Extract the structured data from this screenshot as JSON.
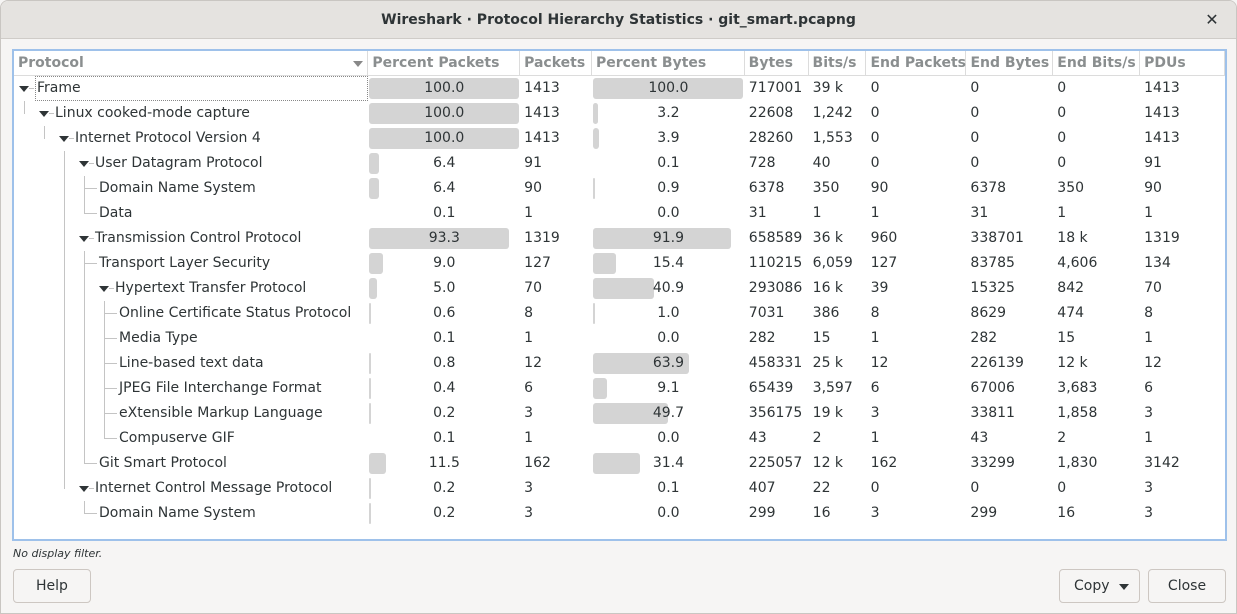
{
  "window": {
    "title": "Wireshark · Protocol Hierarchy Statistics · git_smart.pcapng",
    "close_icon": "close-x-icon"
  },
  "table": {
    "columns": [
      "Protocol",
      "Percent Packets",
      "Packets",
      "Percent Bytes",
      "Bytes",
      "Bits/s",
      "End Packets",
      "End Bytes",
      "End Bits/s",
      "PDUs"
    ],
    "sort_column": "Protocol",
    "rows": [
      {
        "protocol": "Frame",
        "depth": 0,
        "expanded": true,
        "pct_packets": "100.0",
        "packets": "1413",
        "pct_bytes": "100.0",
        "bytes": "717001",
        "bits_s": "39 k",
        "end_packets": "0",
        "end_bytes": "0",
        "end_bits_s": "0",
        "pdus": "1413",
        "pct_packets_val": 100.0,
        "pct_bytes_val": 100.0
      },
      {
        "protocol": "Linux cooked-mode capture",
        "depth": 1,
        "expanded": true,
        "pct_packets": "100.0",
        "packets": "1413",
        "pct_bytes": "3.2",
        "bytes": "22608",
        "bits_s": "1,242",
        "end_packets": "0",
        "end_bytes": "0",
        "end_bits_s": "0",
        "pdus": "1413",
        "pct_packets_val": 100.0,
        "pct_bytes_val": 3.2
      },
      {
        "protocol": "Internet Protocol Version 4",
        "depth": 2,
        "expanded": true,
        "pct_packets": "100.0",
        "packets": "1413",
        "pct_bytes": "3.9",
        "bytes": "28260",
        "bits_s": "1,553",
        "end_packets": "0",
        "end_bytes": "0",
        "end_bits_s": "0",
        "pdus": "1413",
        "pct_packets_val": 100.0,
        "pct_bytes_val": 3.9
      },
      {
        "protocol": "User Datagram Protocol",
        "depth": 3,
        "expanded": true,
        "pct_packets": "6.4",
        "packets": "91",
        "pct_bytes": "0.1",
        "bytes": "728",
        "bits_s": "40",
        "end_packets": "0",
        "end_bytes": "0",
        "end_bits_s": "0",
        "pdus": "91",
        "pct_packets_val": 6.4,
        "pct_bytes_val": 0.1
      },
      {
        "protocol": "Domain Name System",
        "depth": 4,
        "expanded": null,
        "pct_packets": "6.4",
        "packets": "90",
        "pct_bytes": "0.9",
        "bytes": "6378",
        "bits_s": "350",
        "end_packets": "90",
        "end_bytes": "6378",
        "end_bits_s": "350",
        "pdus": "90",
        "pct_packets_val": 6.4,
        "pct_bytes_val": 0.9
      },
      {
        "protocol": "Data",
        "depth": 4,
        "expanded": null,
        "pct_packets": "0.1",
        "packets": "1",
        "pct_bytes": "0.0",
        "bytes": "31",
        "bits_s": "1",
        "end_packets": "1",
        "end_bytes": "31",
        "end_bits_s": "1",
        "pdus": "1",
        "pct_packets_val": 0.1,
        "pct_bytes_val": 0.0
      },
      {
        "protocol": "Transmission Control Protocol",
        "depth": 3,
        "expanded": true,
        "pct_packets": "93.3",
        "packets": "1319",
        "pct_bytes": "91.9",
        "bytes": "658589",
        "bits_s": "36 k",
        "end_packets": "960",
        "end_bytes": "338701",
        "end_bits_s": "18 k",
        "pdus": "1319",
        "pct_packets_val": 93.3,
        "pct_bytes_val": 91.9
      },
      {
        "protocol": "Transport Layer Security",
        "depth": 4,
        "expanded": null,
        "pct_packets": "9.0",
        "packets": "127",
        "pct_bytes": "15.4",
        "bytes": "110215",
        "bits_s": "6,059",
        "end_packets": "127",
        "end_bytes": "83785",
        "end_bits_s": "4,606",
        "pdus": "134",
        "pct_packets_val": 9.0,
        "pct_bytes_val": 15.4
      },
      {
        "protocol": "Hypertext Transfer Protocol",
        "depth": 4,
        "expanded": true,
        "pct_packets": "5.0",
        "packets": "70",
        "pct_bytes": "40.9",
        "bytes": "293086",
        "bits_s": "16 k",
        "end_packets": "39",
        "end_bytes": "15325",
        "end_bits_s": "842",
        "pdus": "70",
        "pct_packets_val": 5.0,
        "pct_bytes_val": 40.9
      },
      {
        "protocol": "Online Certificate Status Protocol",
        "depth": 5,
        "expanded": null,
        "pct_packets": "0.6",
        "packets": "8",
        "pct_bytes": "1.0",
        "bytes": "7031",
        "bits_s": "386",
        "end_packets": "8",
        "end_bytes": "8629",
        "end_bits_s": "474",
        "pdus": "8",
        "pct_packets_val": 0.6,
        "pct_bytes_val": 1.0
      },
      {
        "protocol": "Media Type",
        "depth": 5,
        "expanded": null,
        "pct_packets": "0.1",
        "packets": "1",
        "pct_bytes": "0.0",
        "bytes": "282",
        "bits_s": "15",
        "end_packets": "1",
        "end_bytes": "282",
        "end_bits_s": "15",
        "pdus": "1",
        "pct_packets_val": 0.1,
        "pct_bytes_val": 0.0
      },
      {
        "protocol": "Line-based text data",
        "depth": 5,
        "expanded": null,
        "pct_packets": "0.8",
        "packets": "12",
        "pct_bytes": "63.9",
        "bytes": "458331",
        "bits_s": "25 k",
        "end_packets": "12",
        "end_bytes": "226139",
        "end_bits_s": "12 k",
        "pdus": "12",
        "pct_packets_val": 0.8,
        "pct_bytes_val": 63.9
      },
      {
        "protocol": "JPEG File Interchange Format",
        "depth": 5,
        "expanded": null,
        "pct_packets": "0.4",
        "packets": "6",
        "pct_bytes": "9.1",
        "bytes": "65439",
        "bits_s": "3,597",
        "end_packets": "6",
        "end_bytes": "67006",
        "end_bits_s": "3,683",
        "pdus": "6",
        "pct_packets_val": 0.4,
        "pct_bytes_val": 9.1
      },
      {
        "protocol": "eXtensible Markup Language",
        "depth": 5,
        "expanded": null,
        "pct_packets": "0.2",
        "packets": "3",
        "pct_bytes": "49.7",
        "bytes": "356175",
        "bits_s": "19 k",
        "end_packets": "3",
        "end_bytes": "33811",
        "end_bits_s": "1,858",
        "pdus": "3",
        "pct_packets_val": 0.2,
        "pct_bytes_val": 49.7
      },
      {
        "protocol": "Compuserve GIF",
        "depth": 5,
        "expanded": null,
        "pct_packets": "0.1",
        "packets": "1",
        "pct_bytes": "0.0",
        "bytes": "43",
        "bits_s": "2",
        "end_packets": "1",
        "end_bytes": "43",
        "end_bits_s": "2",
        "pdus": "1",
        "pct_packets_val": 0.1,
        "pct_bytes_val": 0.0
      },
      {
        "protocol": "Git Smart Protocol",
        "depth": 4,
        "expanded": null,
        "pct_packets": "11.5",
        "packets": "162",
        "pct_bytes": "31.4",
        "bytes": "225057",
        "bits_s": "12 k",
        "end_packets": "162",
        "end_bytes": "33299",
        "end_bits_s": "1,830",
        "pdus": "3142",
        "pct_packets_val": 11.5,
        "pct_bytes_val": 31.4
      },
      {
        "protocol": "Internet Control Message Protocol",
        "depth": 3,
        "expanded": true,
        "pct_packets": "0.2",
        "packets": "3",
        "pct_bytes": "0.1",
        "bytes": "407",
        "bits_s": "22",
        "end_packets": "0",
        "end_bytes": "0",
        "end_bits_s": "0",
        "pdus": "3",
        "pct_packets_val": 0.2,
        "pct_bytes_val": 0.1
      },
      {
        "protocol": "Domain Name System",
        "depth": 4,
        "expanded": null,
        "pct_packets": "0.2",
        "packets": "3",
        "pct_bytes": "0.0",
        "bytes": "299",
        "bits_s": "16",
        "end_packets": "3",
        "end_bytes": "299",
        "end_bits_s": "16",
        "pdus": "3",
        "pct_packets_val": 0.2,
        "pct_bytes_val": 0.0
      }
    ]
  },
  "status": {
    "filter_text": "No display filter."
  },
  "buttons": {
    "help": "Help",
    "copy": "Copy",
    "close": "Close"
  },
  "colors": {
    "bar_fill": "#d4d4d4",
    "focus_border": "#9ec1ea"
  }
}
